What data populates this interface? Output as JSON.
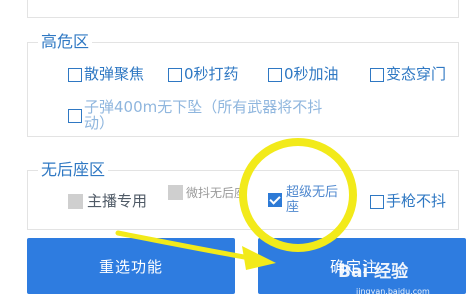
{
  "sections": {
    "high_risk": {
      "title": "高危区",
      "options": [
        {
          "label": "散弹聚焦",
          "checked": false
        },
        {
          "label": "0秒打药",
          "checked": false
        },
        {
          "label": "0秒加油",
          "checked": false
        },
        {
          "label": "变态穿门",
          "checked": false
        },
        {
          "label": "子弹400m无下坠（所有武器将不抖动）",
          "checked": false
        }
      ]
    },
    "no_recoil": {
      "title": "无后座区",
      "options": [
        {
          "label": "主播专用",
          "checked": false,
          "disabled": true
        },
        {
          "label": "微抖无后座",
          "checked": false,
          "disabled": true
        },
        {
          "label": "超级无后座",
          "checked": true
        },
        {
          "label": "手枪不抖",
          "checked": false
        }
      ]
    }
  },
  "buttons": {
    "reset_label": "重选功能",
    "confirm_label": "确定注"
  },
  "watermark": {
    "text": "Bai 经验",
    "sub": "jingyan.baidu.com"
  },
  "annotation_colors": {
    "circle": "#f2ea1a",
    "arrow": "#f2ea1a"
  }
}
